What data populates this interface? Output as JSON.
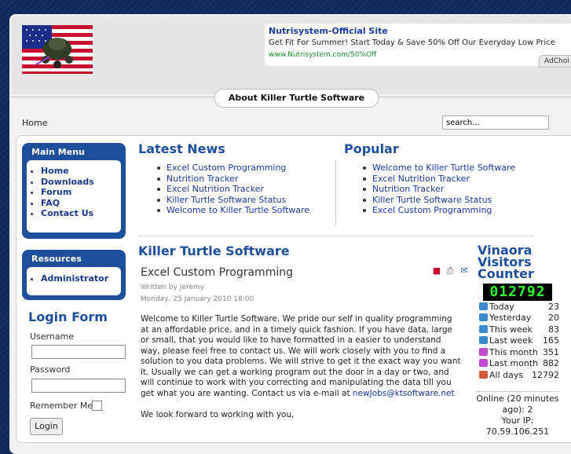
{
  "ad": {
    "title": "Nutrisystem-Official Site",
    "text": "Get Fit For Summer! Start Today & Save 50% Off Our Everyday Low Price",
    "url": "www.Nutrisystem.com/50%Off",
    "choices": "AdChoi"
  },
  "header": {
    "about_tab": "About Killer Turtle Software"
  },
  "breadcrumb": "Home",
  "search": {
    "value": "search..."
  },
  "main_menu": {
    "title": "Main Menu",
    "items": [
      "Home",
      "Downloads",
      "Forum",
      "FAQ",
      "Contact Us"
    ]
  },
  "resources": {
    "title": "Resources",
    "items": [
      "Administrator"
    ]
  },
  "login": {
    "title": "Login Form",
    "username_label": "Username",
    "password_label": "Password",
    "remember_label": "Remember Me",
    "button": "Login"
  },
  "latest_news": {
    "title": "Latest News",
    "items": [
      "Excel Custom Programming",
      "Nutrition Tracker",
      "Excel Nutrition Tracker",
      "Killer Turtle Software Status",
      "Welcome to Killer Turtle Software"
    ]
  },
  "popular": {
    "title": "Popular",
    "items": [
      "Welcome to Killer Turtle Software",
      "Excel Nutrition Tracker",
      "Nutrition Tracker",
      "Killer Turtle Software Status",
      "Excel Custom Programming"
    ]
  },
  "section": {
    "title": "Killer Turtle Software"
  },
  "article": {
    "title": "Excel Custom Programming",
    "author": "Written by Jeremy",
    "date": "Monday, 25 January 2010 18:00",
    "body": "Welcome to Killer Turtle Software.  We pride our self in quality programming at an affordable price, and in a timely quick fashion.  If you have data, large or small, that you would like to have formatted in a easier to understand way, please feel free to contact us.  We will work closely with you to find a solution to you data problems.  We will strive to get it the exact way you want it.  Usually we can get a working program out the door in a day or two, and will continue to work with you correcting and manipulating the data till you get what you are wanting.  Contact us via e-mail at ",
    "email": "newJobs@ktsoftware.net",
    "closing": "We look forward to working with you,"
  },
  "counter": {
    "title_line1": "Vinaora",
    "title_line2": "Visitors",
    "title_line3": "Counter",
    "display": "012792",
    "stats": [
      {
        "label": "Today",
        "value": "23",
        "color": "#3a8ad0"
      },
      {
        "label": "Yesterday",
        "value": "20",
        "color": "#3a8ad0"
      },
      {
        "label": "This week",
        "value": "83",
        "color": "#3a8ad0"
      },
      {
        "label": "Last week",
        "value": "165",
        "color": "#3a8ad0"
      },
      {
        "label": "This month",
        "value": "351",
        "color": "#c04ad0"
      },
      {
        "label": "Last month",
        "value": "882",
        "color": "#c04ad0"
      },
      {
        "label": "All days",
        "value": "12792",
        "color": "#d05a3a"
      }
    ],
    "online_line1": "Online (20 minutes",
    "online_line2": "ago): 2",
    "your_ip": "Your IP:",
    "ip": "70.59.106.251"
  }
}
